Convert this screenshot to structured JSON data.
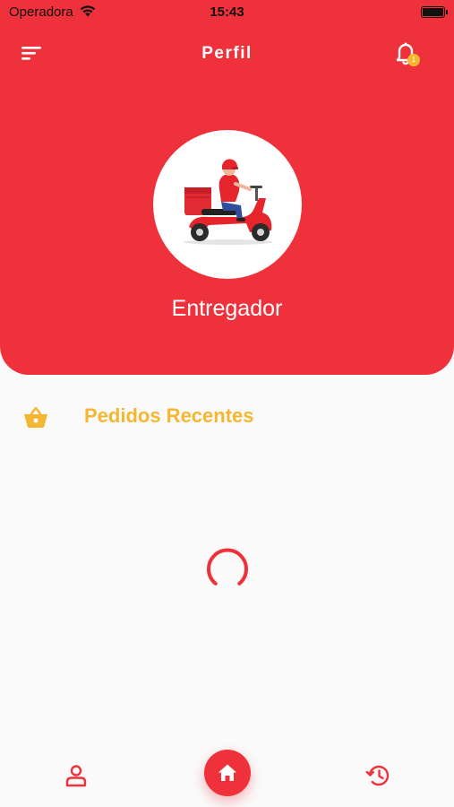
{
  "status_bar": {
    "carrier": "Operadora",
    "time": "15:43"
  },
  "header": {
    "title": "Perfil",
    "notification_count": "1"
  },
  "profile": {
    "name": "Entregador"
  },
  "section": {
    "title": "Pedidos Recentes"
  },
  "colors": {
    "primary": "#ef313b",
    "accent": "#f5b731",
    "background": "#fafafa"
  },
  "icons": {
    "menu": "menu-icon",
    "notification": "bell-icon",
    "section": "basket-icon",
    "loading": "spinner",
    "nav_profile": "person-icon",
    "nav_home": "home-icon",
    "nav_history": "history-icon"
  }
}
